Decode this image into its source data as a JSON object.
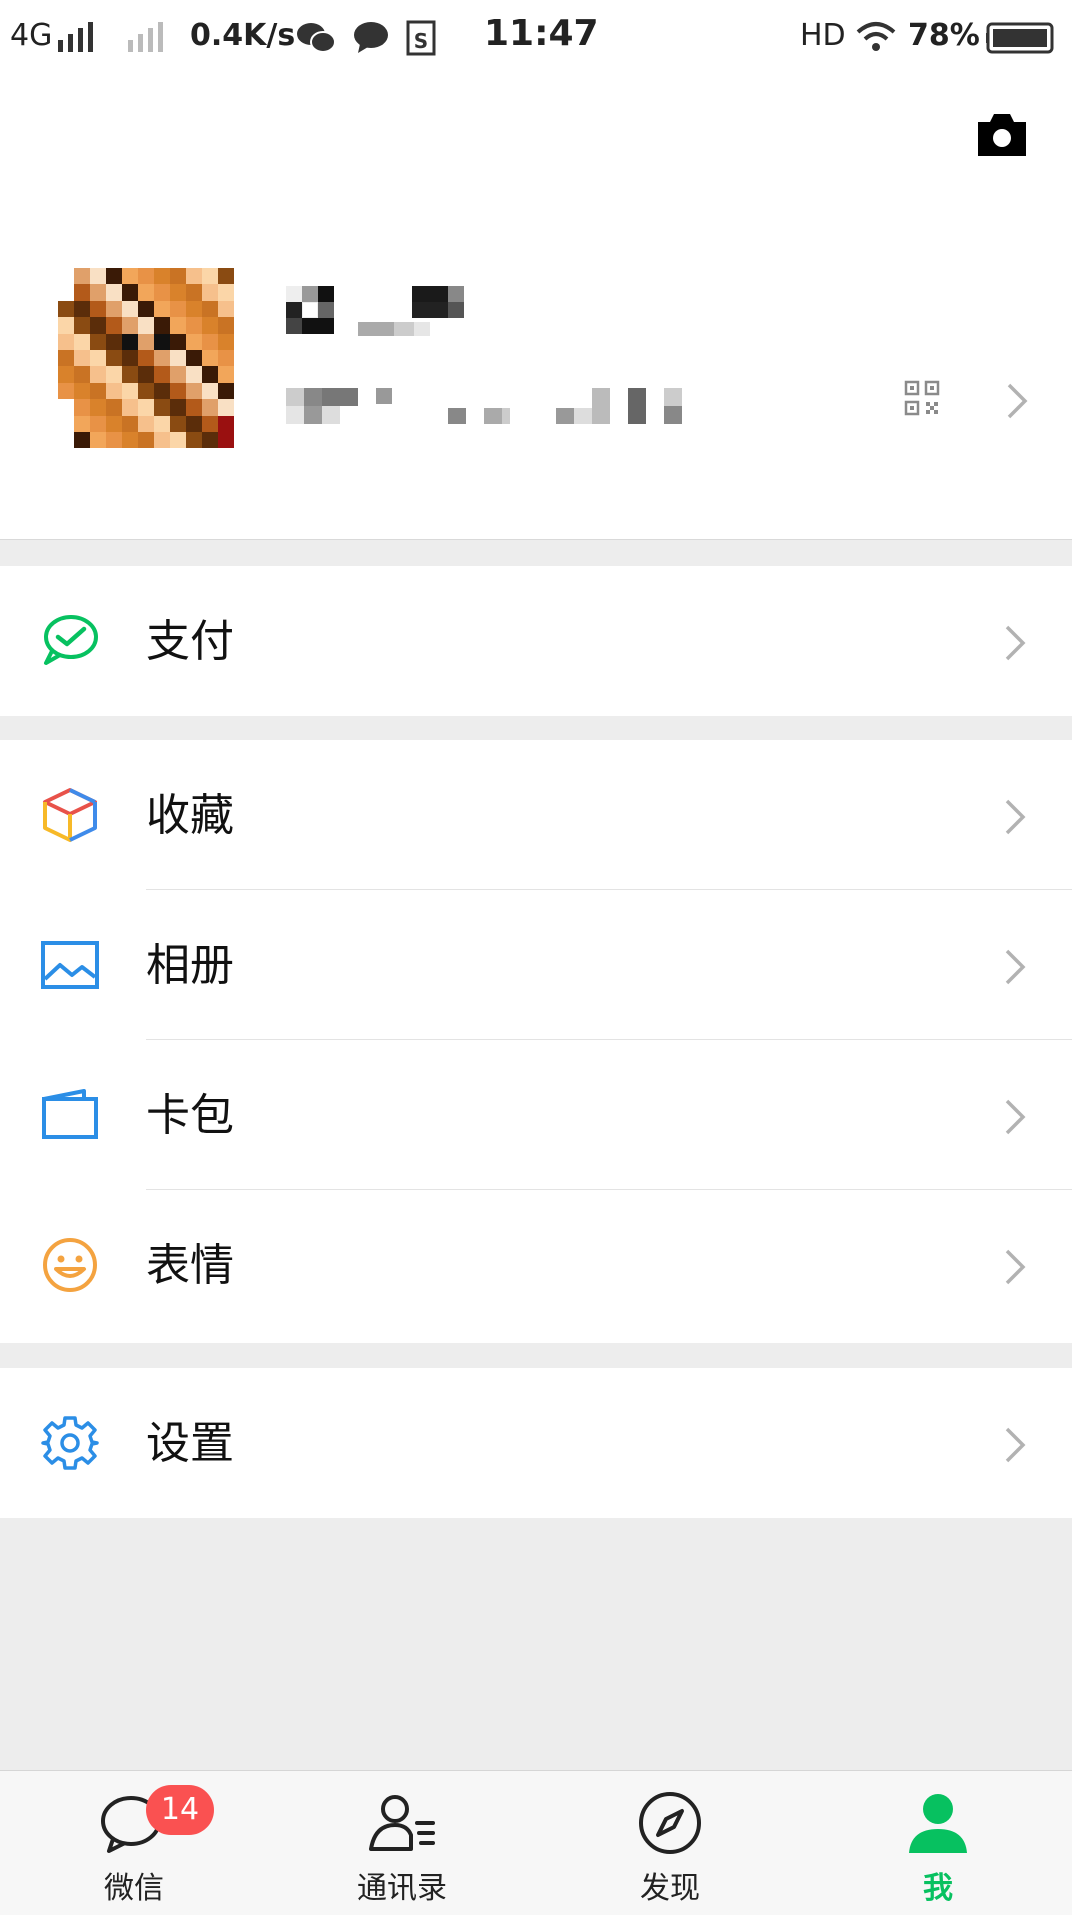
{
  "status_bar": {
    "network": "4G",
    "speed": "0.4K/s",
    "time": "11:47",
    "hd": "HD",
    "battery": "78%"
  },
  "header": {
    "camera_icon": "camera-icon",
    "qr_icon": "qr-code-icon"
  },
  "menu": {
    "pay": {
      "label": "支付",
      "icon": "wechat-pay-icon",
      "color": "#07c160"
    },
    "favorites": {
      "label": "收藏",
      "icon": "cube-icon"
    },
    "album": {
      "label": "相册",
      "icon": "image-icon",
      "color": "#2b8ee6"
    },
    "cards": {
      "label": "卡包",
      "icon": "card-wallet-icon",
      "color": "#2b8ee6"
    },
    "stickers": {
      "label": "表情",
      "icon": "smiley-icon",
      "color": "#f4a340"
    },
    "settings": {
      "label": "设置",
      "icon": "gear-icon",
      "color": "#2b8ee6"
    }
  },
  "tabbar": {
    "chats": {
      "label": "微信",
      "badge": "14"
    },
    "contacts": {
      "label": "通讯录"
    },
    "discover": {
      "label": "发现"
    },
    "me": {
      "label": "我",
      "color": "#07c160"
    }
  }
}
